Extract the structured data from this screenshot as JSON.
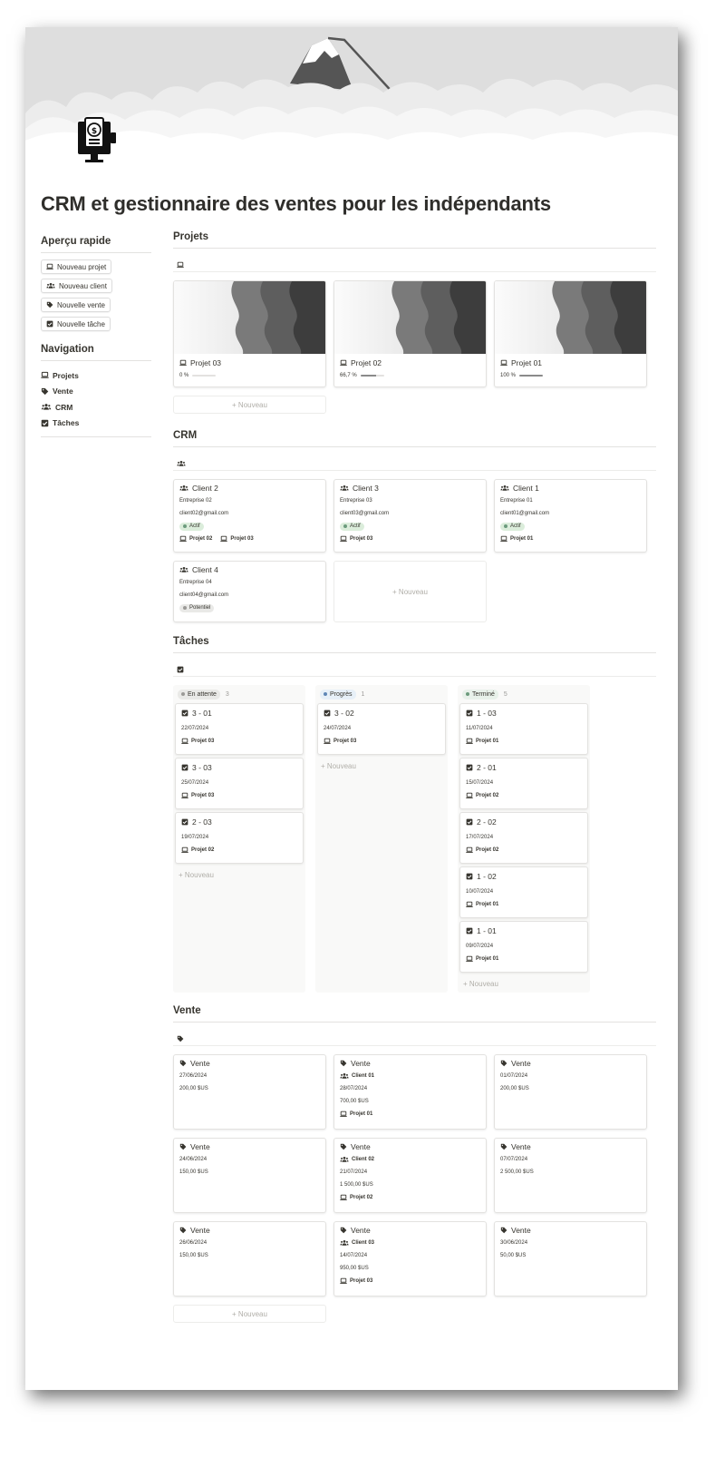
{
  "title": "CRM et gestionnaire des ventes pour les indépendants",
  "icons": {
    "project": "laptop-icon",
    "client": "people-icon",
    "sale": "tag-icon",
    "task": "checkbox-icon"
  },
  "sidebar": {
    "quick_heading": "Aperçu rapide",
    "quick_buttons": [
      "Nouveau projet",
      "Nouveau client",
      "Nouvelle vente",
      "Nouvelle tâche"
    ],
    "nav_heading": "Navigation",
    "nav_items": [
      "Projets",
      "Vente",
      "CRM",
      "Tâches"
    ]
  },
  "new_label": "+ Nouveau",
  "projects": {
    "heading": "Projets",
    "items": [
      {
        "name": "Projet 03",
        "progress_label": "0 %",
        "progress": 0
      },
      {
        "name": "Projet 02",
        "progress_label": "66,7 %",
        "progress": 0.667
      },
      {
        "name": "Projet 01",
        "progress_label": "100 %",
        "progress": 1
      }
    ]
  },
  "crm": {
    "heading": "CRM",
    "clients": [
      {
        "name": "Client 2",
        "company": "Entreprise 02",
        "email": "client02@gmail.com",
        "status": "Actif",
        "projects": [
          "Projet 02",
          "Projet 03"
        ]
      },
      {
        "name": "Client 3",
        "company": "Entreprise 03",
        "email": "client03@gmail.com",
        "status": "Actif",
        "projects": [
          "Projet 03"
        ]
      },
      {
        "name": "Client 1",
        "company": "Entreprise 01",
        "email": "client01@gmail.com",
        "status": "Actif",
        "projects": [
          "Projet 01"
        ]
      },
      {
        "name": "Client 4",
        "company": "Entreprise 04",
        "email": "client04@gmail.com",
        "status": "Potentiel",
        "projects": []
      }
    ],
    "status_colors": {
      "Actif": "#dbeddb",
      "Potentiel": "#e9e9e7"
    },
    "status_dot_colors": {
      "Actif": "#6c9b7d",
      "Potentiel": "#9b9a97"
    }
  },
  "tasks": {
    "heading": "Tâches",
    "columns": [
      {
        "name": "En attente",
        "count": "3",
        "color": "#e9e9e7",
        "dot": "#9b9a97",
        "cards": [
          {
            "name": "3 - 01",
            "date": "22/07/2024",
            "project": "Projet 03"
          },
          {
            "name": "3 - 03",
            "date": "25/07/2024",
            "project": "Projet 03"
          },
          {
            "name": "2 - 03",
            "date": "19/07/2024",
            "project": "Projet 02"
          }
        ]
      },
      {
        "name": "Progrès",
        "count": "1",
        "color": "#e7f0f8",
        "dot": "#5e87b6",
        "cards": [
          {
            "name": "3 - 02",
            "date": "24/07/2024",
            "project": "Projet 03"
          }
        ]
      },
      {
        "name": "Terminé",
        "count": "5",
        "color": "#e8f1ea",
        "dot": "#6c9b7d",
        "cards": [
          {
            "name": "1 - 03",
            "date": "11/07/2024",
            "project": "Projet 01"
          },
          {
            "name": "2 - 01",
            "date": "15/07/2024",
            "project": "Projet 02"
          },
          {
            "name": "2 - 02",
            "date": "17/07/2024",
            "project": "Projet 02"
          },
          {
            "name": "1 - 02",
            "date": "10/07/2024",
            "project": "Projet 01"
          },
          {
            "name": "1 - 01",
            "date": "09/07/2024",
            "project": "Projet 01"
          }
        ]
      }
    ]
  },
  "sales": {
    "heading": "Vente",
    "items": [
      {
        "name": "Vente",
        "client": "",
        "date": "27/06/2024",
        "amount": "200,00 $US",
        "project": ""
      },
      {
        "name": "Vente",
        "client": "Client 01",
        "date": "28/07/2024",
        "amount": "700,00 $US",
        "project": "Projet 01"
      },
      {
        "name": "Vente",
        "client": "",
        "date": "01/07/2024",
        "amount": "200,00 $US",
        "project": ""
      },
      {
        "name": "Vente",
        "client": "",
        "date": "24/06/2024",
        "amount": "150,00 $US",
        "project": ""
      },
      {
        "name": "Vente",
        "client": "Client 02",
        "date": "21/07/2024",
        "amount": "1 500,00 $US",
        "project": "Projet 02"
      },
      {
        "name": "Vente",
        "client": "",
        "date": "07/07/2024",
        "amount": "2 500,00 $US",
        "project": ""
      },
      {
        "name": "Vente",
        "client": "",
        "date": "26/06/2024",
        "amount": "150,00 $US",
        "project": ""
      },
      {
        "name": "Vente",
        "client": "Client 03",
        "date": "14/07/2024",
        "amount": "950,00 $US",
        "project": "Projet 03"
      },
      {
        "name": "Vente",
        "client": "",
        "date": "30/06/2024",
        "amount": "50,00 $US",
        "project": ""
      }
    ]
  }
}
